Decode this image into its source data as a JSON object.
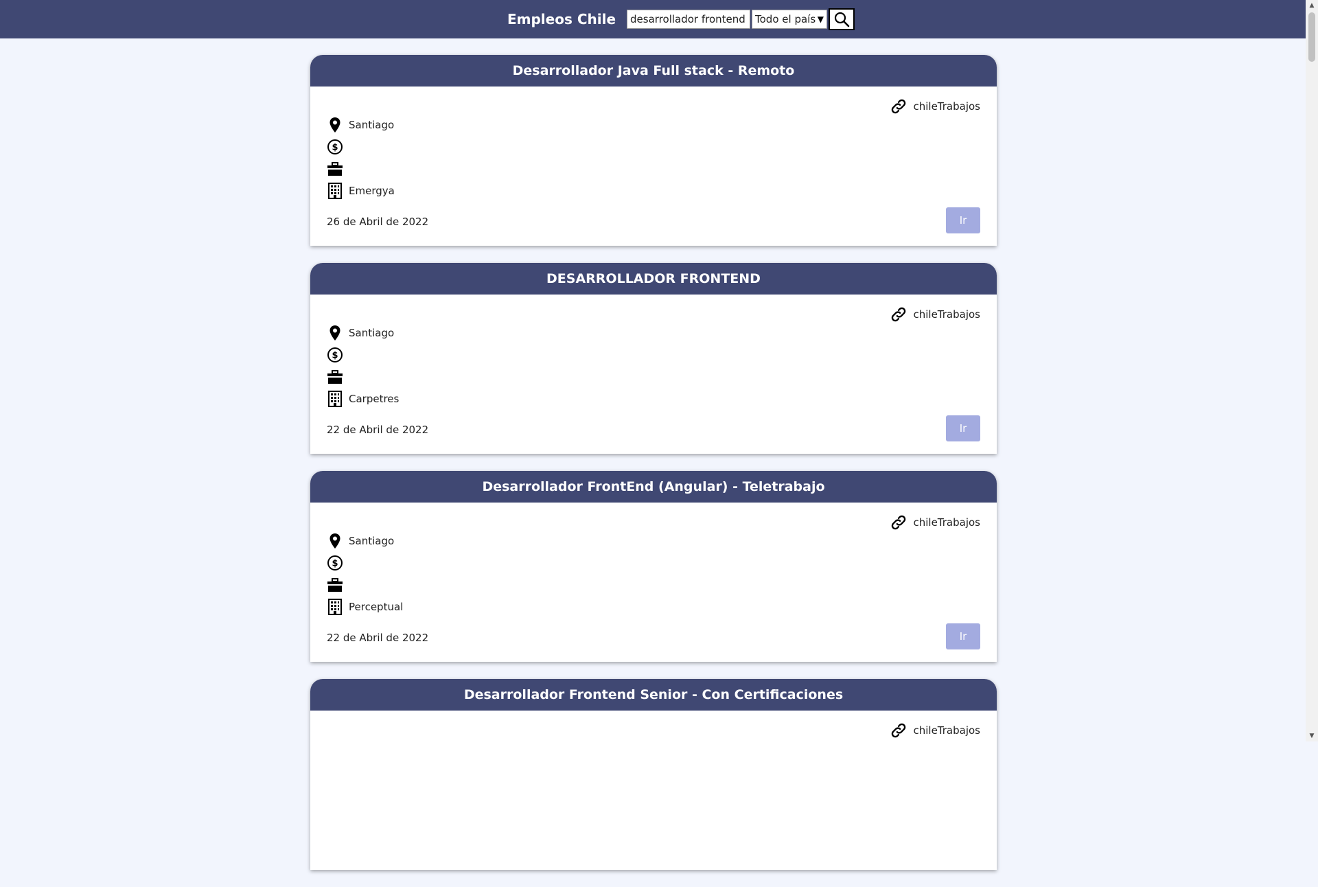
{
  "header": {
    "brand": "Empleos Chile",
    "search_value": "desarrollador frontend",
    "region_selected": "Todo el país",
    "search_icon": "search-icon"
  },
  "colors": {
    "header_bg": "#404873",
    "page_bg": "#f2f5fd",
    "button_bg": "#a3abe0"
  },
  "jobs": [
    {
      "title": "Desarrollador Java Full stack - Remoto",
      "source": "chileTrabajos",
      "location": "Santiago",
      "salary": "",
      "type": "",
      "company": "Emergya",
      "date": "26 de Abril de 2022",
      "button": "Ir"
    },
    {
      "title": "DESARROLLADOR FRONTEND",
      "source": "chileTrabajos",
      "location": "Santiago",
      "salary": "",
      "type": "",
      "company": "Carpetres",
      "date": "22 de Abril de 2022",
      "button": "Ir"
    },
    {
      "title": "Desarrollador FrontEnd (Angular) - Teletrabajo",
      "source": "chileTrabajos",
      "location": "Santiago",
      "salary": "",
      "type": "",
      "company": "Perceptual",
      "date": "22 de Abril de 2022",
      "button": "Ir"
    },
    {
      "title": "Desarrollador Frontend Senior - Con Certificaciones",
      "source": "chileTrabajos",
      "location": "",
      "salary": "",
      "type": "",
      "company": "",
      "date": "",
      "button": ""
    }
  ]
}
